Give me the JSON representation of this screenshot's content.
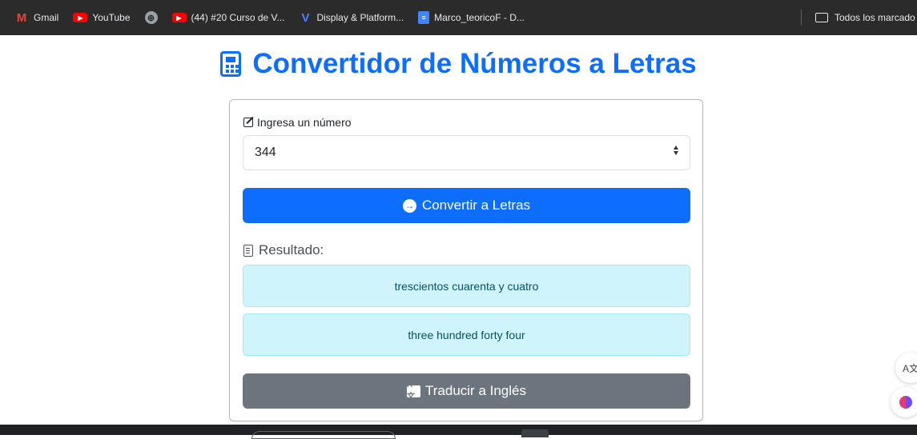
{
  "bookmarks": [
    {
      "label": "Gmail",
      "icon": "gmail-icon",
      "glyph": "M"
    },
    {
      "label": "YouTube",
      "icon": "youtube-icon",
      "glyph": "▶"
    },
    {
      "label": "",
      "icon": "globe-icon",
      "glyph": "⊕"
    },
    {
      "label": "(44) #20 Curso de V...",
      "icon": "youtube-icon",
      "glyph": "▶"
    },
    {
      "label": "Display & Platform...",
      "icon": "v-logo-icon",
      "glyph": "V"
    },
    {
      "label": "Marco_teoricoF - D...",
      "icon": "docs-icon",
      "glyph": "≡"
    }
  ],
  "bookmarks_folder": {
    "label": "Todos los marcado"
  },
  "page": {
    "title": "Convertidor de Números a Letras"
  },
  "form": {
    "input_label": "Ingresa un número",
    "input_value": "344",
    "convert_button": "Convertir a Letras",
    "result_label": "Resultado:",
    "result_spanish": "trescientos cuarenta y cuatro",
    "result_english": "three hundred forty four",
    "translate_button": "Traducir a Inglés"
  },
  "colors": {
    "primary": "#0d6efd",
    "secondary": "#6c757d",
    "alert_bg": "#cff4fc",
    "alert_text": "#055160"
  }
}
